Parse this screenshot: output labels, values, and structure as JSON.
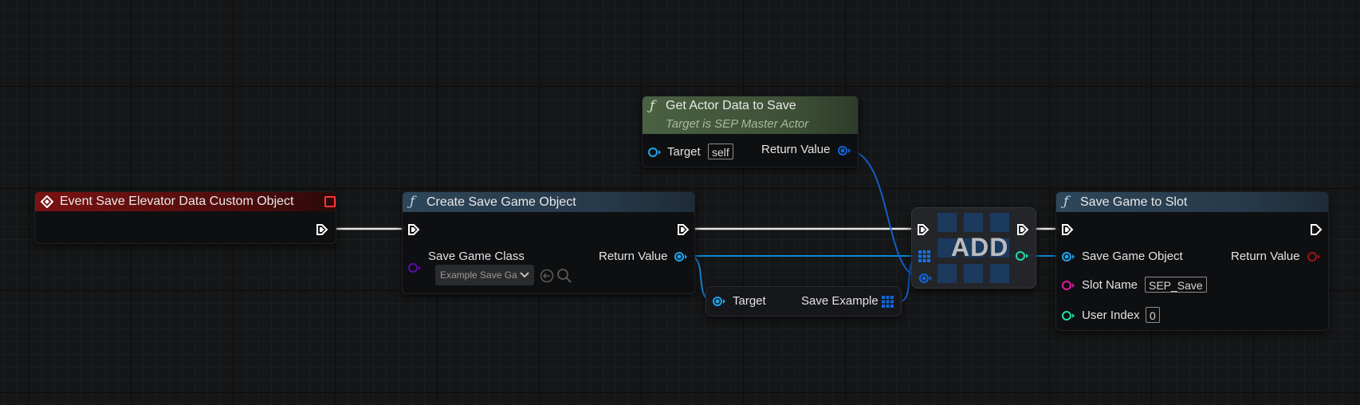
{
  "nodes": {
    "event": {
      "title": "Event Save Elevator Data Custom Object",
      "icon": "event-diamond-icon",
      "header_color": "#6a1111"
    },
    "create_save": {
      "title": "Create Save Game Object",
      "icon": "function-icon",
      "header_color": "#2b3e4e",
      "inputs": {
        "save_game_class_label": "Save Game Class",
        "save_game_class_value": "Example Save Ga"
      },
      "outputs": {
        "return_value_label": "Return Value"
      }
    },
    "get_actor": {
      "title": "Get Actor Data to Save",
      "subtitle": "Target is SEP Master Actor",
      "icon": "function-icon",
      "header_color": "#3f5238",
      "inputs": {
        "target_label": "Target",
        "target_value": "self"
      },
      "outputs": {
        "return_value_label": "Return Value"
      }
    },
    "get_var": {
      "target_label": "Target",
      "output_label": "Save Example",
      "output_icon": "array-grid-icon"
    },
    "add": {
      "label": "ADD"
    },
    "save_slot": {
      "title": "Save Game to Slot",
      "icon": "function-icon",
      "header_color": "#2b3e4e",
      "inputs": {
        "save_game_object_label": "Save Game Object",
        "slot_name_label": "Slot Name",
        "slot_name_value": "SEP_Save",
        "user_index_label": "User Index",
        "user_index_value": "0"
      },
      "outputs": {
        "return_value_label": "Return Value"
      }
    }
  },
  "colors": {
    "exec": "#ffffff",
    "object": "#1fa5ef",
    "class": "#5c0bb0",
    "string": "#e11aa5",
    "integer": "#1fdfa8",
    "boolean": "#8c0f0f"
  }
}
